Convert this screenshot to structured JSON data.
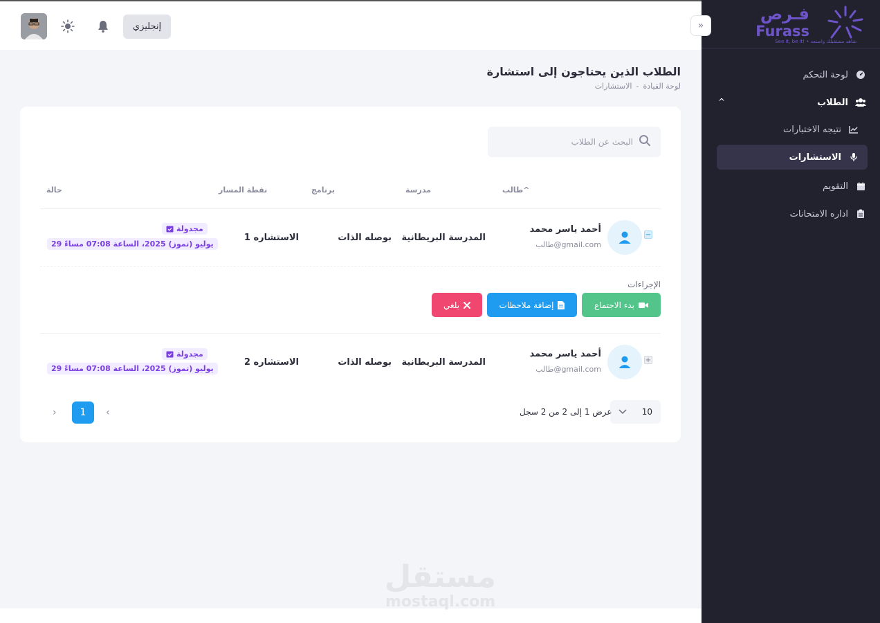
{
  "sidebar": {
    "logo": {
      "arabic": "فـرص",
      "english": "Furass",
      "tagline": "See it, be it! • شاهد مستقبلك واصنعه"
    },
    "items": [
      {
        "label": "لوحة التحكم",
        "icon": "dashboard-icon"
      },
      {
        "label": "الطلاب",
        "icon": "users-icon"
      },
      {
        "label": "نتيجه الاختبارات",
        "icon": "chart-icon"
      },
      {
        "label": "الاستشارات",
        "icon": "microphone-icon"
      },
      {
        "label": "التقويم",
        "icon": "calendar-icon"
      },
      {
        "label": "اداره الامتحانات",
        "icon": "clipboard-icon"
      }
    ]
  },
  "header": {
    "language_button": "إنجليزي"
  },
  "page": {
    "title": "الطلاب الذين يحتاجون إلى استشارة",
    "breadcrumb": [
      "لوحة القيادة",
      "-",
      "الاستشارات"
    ]
  },
  "search": {
    "placeholder": "البحث عن الطلاب"
  },
  "table": {
    "headers": {
      "student": "طالب^",
      "school": "مدرسة",
      "program": "برنامج",
      "milestone": "نقطة المسار",
      "status": "حالة"
    },
    "rows": [
      {
        "name": "أحمد ياسر محمد",
        "email": "طالب@gmail.com",
        "school": "المدرسة البريطانية",
        "program": "بوصله الذات",
        "milestone": "1 الاستشاره",
        "status": "مجدولة",
        "date": "29 يوليو (تموز) 2025، الساعة 07:08 مساءً"
      },
      {
        "name": "أحمد ياسر محمد",
        "email": "طالب@gmail.com",
        "school": "المدرسة البريطانية",
        "program": "بوصله الذات",
        "milestone": "2 الاستشاره",
        "status": "مجدولة",
        "date": "29 يوليو (تموز) 2025، الساعة 07:08 مساءً"
      }
    ]
  },
  "actions": {
    "label": "الإجراءات",
    "start": "بدء الاجتماع",
    "notes": "إضافة ملاحظات",
    "cancel": "يلغي"
  },
  "pagination": {
    "page_size": "10",
    "info": "عرض 1 إلى 2 من 2 سجل",
    "current": "1"
  },
  "watermark": {
    "arabic": "مستقل",
    "english": "mostaql.com"
  }
}
